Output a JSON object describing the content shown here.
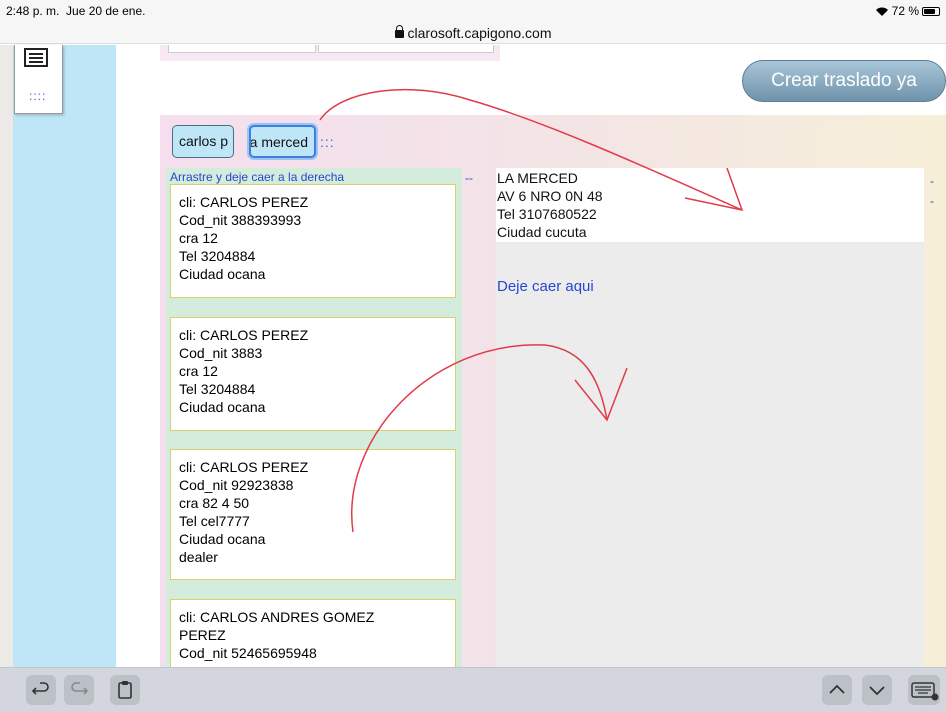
{
  "status_bar": {
    "time": "2:48 p. m.",
    "date": "Jue 20 de ene.",
    "battery": "72 %",
    "url": "clarosoft.capigono.com"
  },
  "side_menu": {
    "dots": "::::"
  },
  "create_button": {
    "label": "Crear traslado ya"
  },
  "chips": [
    {
      "label": "carlos p"
    },
    {
      "label": "la merced"
    }
  ],
  "chips_dots": ":::",
  "list": {
    "heading": "Arrastre y deje caer a la derecha",
    "dash": "--",
    "cards": [
      {
        "lines": [
          "cli: CARLOS PEREZ",
          "Cod_nit 388393993",
          "cra 12",
          "Tel 3204884",
          "Ciudad ocana"
        ]
      },
      {
        "lines": [
          "cli: CARLOS PEREZ",
          "Cod_nit 3883",
          "cra 12",
          "Tel 3204884",
          "Ciudad ocana"
        ]
      },
      {
        "lines": [
          "cli: CARLOS PEREZ",
          "Cod_nit 92923838",
          "cra 82 4 50",
          "Tel cel7777",
          "Ciudad ocana",
          "dealer"
        ]
      },
      {
        "lines": [
          "cli: CARLOS ANDRES GOMEZ",
          "PEREZ",
          "Cod_nit 52465695948"
        ]
      }
    ]
  },
  "target": {
    "lines": [
      "LA MERCED",
      "AV 6 NRO 0N 48",
      "Tel 3107680522",
      "Ciudad cucuta"
    ],
    "drop_label": "Deje caer aqui",
    "dash": "-"
  },
  "colors": {
    "annotation": "#e23a4a",
    "link_blue": "#2747d0"
  }
}
